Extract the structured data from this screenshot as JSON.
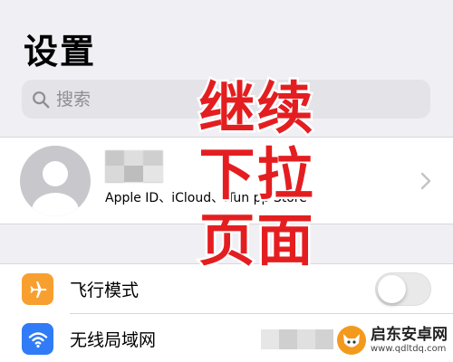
{
  "header": {
    "title": "设置"
  },
  "search": {
    "placeholder": "搜索"
  },
  "profile": {
    "subtitle": "Apple ID、iCloud、iTun    pp Store"
  },
  "overlay": {
    "lines": [
      "继续",
      "下拉",
      "页面"
    ],
    "color": "#e41e20"
  },
  "settings": {
    "rows": [
      {
        "label": "飞行模式",
        "icon": "airplane-icon",
        "icon_color": "#f7a030",
        "toggle_on": false
      },
      {
        "label": "无线局域网",
        "icon": "wifi-icon",
        "icon_color": "#2f7cf6"
      }
    ]
  },
  "watermark": {
    "title": "启东安卓网",
    "url": "www.qdltdq.com",
    "icon": "fox-logo-icon"
  }
}
